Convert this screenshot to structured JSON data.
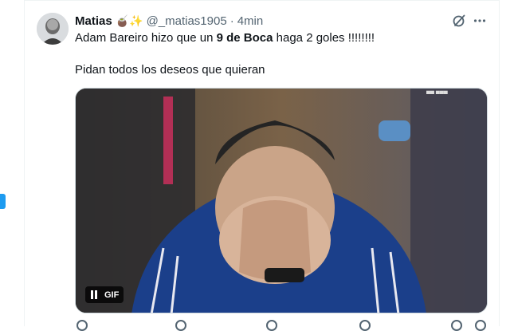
{
  "tweet": {
    "author_name": "Matias",
    "author_emojis": "🧉✨",
    "handle": "@_matias1905",
    "separator": "·",
    "time": "4min",
    "text_line1_a": "Adam Bareiro hizo que un ",
    "text_line1_bold": "9 de Boca",
    "text_line1_b": " haga 2 goles !!!!!!!!",
    "text_line2": "Pidan todos los deseos que quieran"
  },
  "media": {
    "badge": "GIF"
  },
  "icons": {
    "grok": "grok-icon",
    "more": "more-icon",
    "pause": "pause-icon"
  },
  "colors": {
    "accent": "#1d9bf0",
    "secondary_text": "#536471",
    "border": "#eff3f4"
  }
}
